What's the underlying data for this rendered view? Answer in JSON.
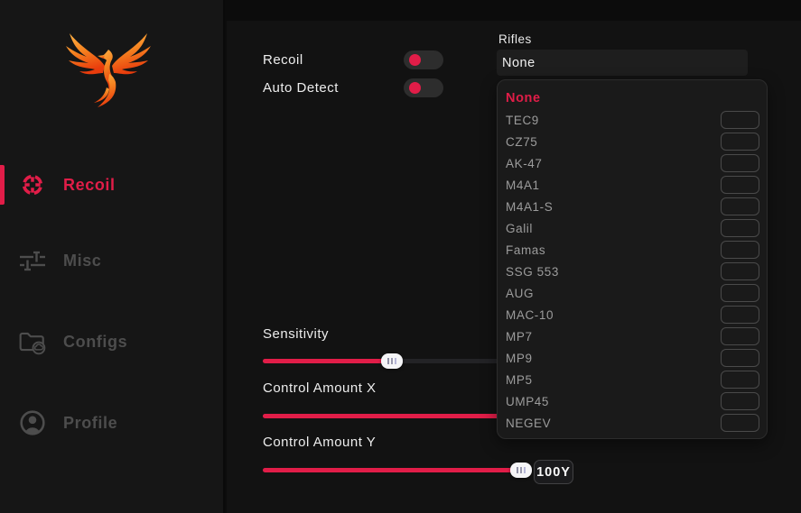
{
  "colors": {
    "accent": "#e11d48",
    "sidebar_bg": "#161616",
    "main_bg": "#121212",
    "titlebar_bg": "#0c0c0c",
    "panel_bg": "#1a1a1a",
    "select_bg": "#1e1e1e",
    "muted_text": "#9c9c9c",
    "sidebar_inactive": "#4d4d4d",
    "logo_gradient_top": "#ffb547",
    "logo_gradient_bottom": "#e93c0c"
  },
  "sidebar": {
    "items": [
      {
        "label": "Recoil",
        "icon": "crosshair-icon",
        "active": true
      },
      {
        "label": "Misc",
        "icon": "tune-icon",
        "active": false
      },
      {
        "label": "Configs",
        "icon": "folder-cloud-icon",
        "active": false
      },
      {
        "label": "Profile",
        "icon": "user-circle-icon",
        "active": false
      }
    ]
  },
  "toggles": [
    {
      "label": "Recoil",
      "state": "on"
    },
    {
      "label": "Auto Detect",
      "state": "on"
    }
  ],
  "rifles": {
    "label": "Rifles",
    "selected": "None",
    "options": [
      {
        "label": "None",
        "selected": true,
        "keybind_box": false
      },
      {
        "label": "TEC9",
        "selected": false,
        "keybind_box": true
      },
      {
        "label": "CZ75",
        "selected": false,
        "keybind_box": true
      },
      {
        "label": "AK-47",
        "selected": false,
        "keybind_box": true
      },
      {
        "label": "M4A1",
        "selected": false,
        "keybind_box": true
      },
      {
        "label": "M4A1-S",
        "selected": false,
        "keybind_box": true
      },
      {
        "label": "Galil",
        "selected": false,
        "keybind_box": true
      },
      {
        "label": "Famas",
        "selected": false,
        "keybind_box": true
      },
      {
        "label": "SSG 553",
        "selected": false,
        "keybind_box": true
      },
      {
        "label": "AUG",
        "selected": false,
        "keybind_box": true
      },
      {
        "label": "MAC-10",
        "selected": false,
        "keybind_box": true
      },
      {
        "label": "MP7",
        "selected": false,
        "keybind_box": true
      },
      {
        "label": "MP9",
        "selected": false,
        "keybind_box": true
      },
      {
        "label": "MP5",
        "selected": false,
        "keybind_box": true
      },
      {
        "label": "UMP45",
        "selected": false,
        "keybind_box": true
      },
      {
        "label": "NEGEV",
        "selected": false,
        "keybind_box": true
      }
    ]
  },
  "sliders": [
    {
      "label": "Sensitivity",
      "fill_percent": 26.5,
      "value_label": ""
    },
    {
      "label": "Control Amount X",
      "fill_percent": 100,
      "value_label": ""
    },
    {
      "label": "Control Amount Y",
      "fill_percent": 100,
      "value_label": "100Y"
    }
  ]
}
